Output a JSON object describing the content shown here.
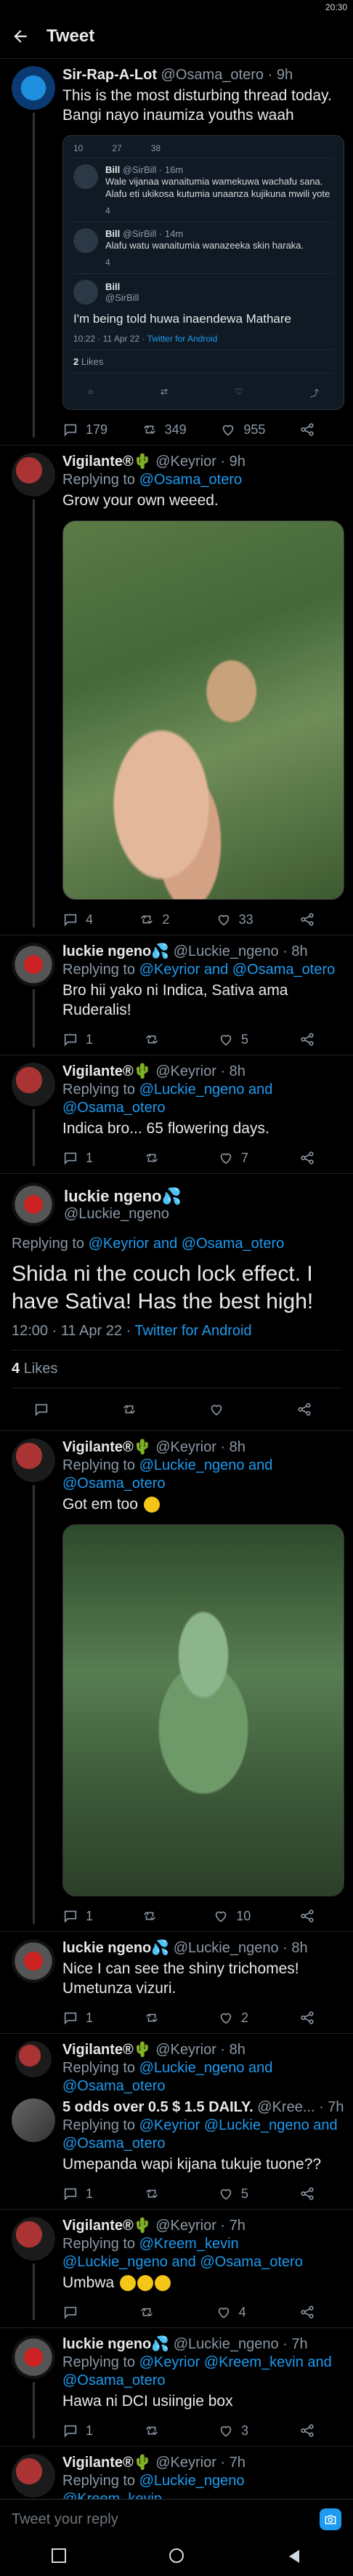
{
  "status": {
    "time": "20:30",
    "network": "4G",
    "battery": ""
  },
  "header": {
    "title": "Tweet"
  },
  "tweets": [
    {
      "name": "Sir-Rap-A-Lot",
      "handle": "@Osama_otero",
      "time": "9h",
      "text": "This is the most disturbing thread today. Bangi nayo inaumiza youths waah",
      "quote": {
        "rows": [
          {
            "name": "Bill",
            "handle": "@SirBill",
            "time": "16m",
            "text": "Wale vijanaa wanaitumia wamekuwa wachafu sana. Alafu eti ukikosa kutumia unaanza kujikuna mwili yote",
            "replies": "",
            "retweets": "",
            "likes": "4"
          },
          {
            "name": "Bill",
            "handle": "@SirBill",
            "time": "14m",
            "text": "Alafu watu wanaitumia wanazeeka skin haraka.",
            "replies": "",
            "retweets": "",
            "likes": "4"
          }
        ],
        "top_counts": {
          "replies": "10",
          "retweets": "27",
          "likes": "38"
        },
        "main_name": "Bill",
        "main_handle": "@SirBill",
        "main_text": "I'm being told huwa inaendewa Mathare",
        "main_meta": "10:22 · 11 Apr 22 · ",
        "main_meta_link": "Twitter for Android",
        "likes_count": "2",
        "likes_label": "Likes"
      },
      "replies": "179",
      "retweets": "349",
      "likes": "955"
    },
    {
      "name": "Vigilante®🌵",
      "handle": "@Keyrior",
      "time": "9h",
      "reply_to_prefix": "Replying to",
      "reply_to": "@Osama_otero",
      "text": "Grow your own weeed.",
      "replies": "4",
      "retweets": "2",
      "likes": "33"
    },
    {
      "name": "luckie ngeno💦",
      "handle": "@Luckie_ngeno",
      "time": "8h",
      "reply_to_prefix": "Replying to",
      "reply_to": "@Keyrior and @Osama_otero",
      "text": "Bro hii yako ni Indica, Sativa ama Ruderalis!",
      "replies": "1",
      "retweets": "",
      "likes": "5"
    },
    {
      "name": "Vigilante®🌵",
      "handle": "@Keyrior",
      "time": "8h",
      "reply_to_prefix": "Replying to",
      "reply_to": "@Luckie_ngeno and @Osama_otero",
      "text": "Indica bro... 65 flowering days.",
      "replies": "1",
      "retweets": "",
      "likes": "7"
    }
  ],
  "main_tweet": {
    "name": "luckie ngeno💦",
    "handle": "@Luckie_ngeno",
    "reply_to_prefix": "Replying to",
    "reply_to": "@Keyrior and @Osama_otero",
    "text": "Shida ni the couch lock effect. I have Sativa! Has the best high!",
    "meta": "12:00 · 11 Apr 22 · ",
    "meta_link": "Twitter for Android",
    "likes_count": "4",
    "likes_label": "Likes"
  },
  "replies_after": [
    {
      "name": "Vigilante®🌵",
      "handle": "@Keyrior",
      "time": "8h",
      "reply_to_prefix": "Replying to",
      "reply_to": "@Luckie_ngeno and @Osama_otero",
      "text": "Got em too",
      "replies": "1",
      "retweets": "",
      "likes": "10"
    },
    {
      "name": "luckie ngeno💦",
      "handle": "@Luckie_ngeno",
      "time": "8h",
      "text": "Nice I can see the shiny trichomes! Umetunza vizuri.",
      "replies": "1",
      "retweets": "",
      "likes": "2"
    },
    {
      "name": "Vigilante®🌵",
      "handle": "@Keyrior",
      "time": "8h",
      "reply_to_prefix": "Replying to",
      "reply_to": "@Luckie_ngeno and @Osama_otero",
      "text": "",
      "replies": "",
      "retweets": "",
      "likes": ""
    },
    {
      "name": "5 odds over 0.5 $ 1.5 DAILY.",
      "handle": "@Kree...",
      "time": "7h",
      "reply_to_prefix": "Replying to",
      "reply_to": "@Keyrior @Luckie_ngeno and @Osama_otero",
      "text": "Umepanda wapi kijana tukuje tuone??",
      "replies": "1",
      "retweets": "",
      "likes": "5"
    },
    {
      "name": "Vigilante®🌵",
      "handle": "@Keyrior",
      "time": "7h",
      "reply_to_prefix": "Replying to",
      "reply_to": "@Kreem_kevin @Luckie_ngeno and @Osama_otero",
      "text": "Umbwa",
      "replies": "",
      "retweets": "",
      "likes": "4"
    },
    {
      "name": "luckie ngeno💦",
      "handle": "@Luckie_ngeno",
      "time": "7h",
      "reply_to_prefix": "Replying to",
      "reply_to": "@Keyrior @Kreem_kevin and @Osama_otero",
      "text": "Hawa ni DCI usiingie box",
      "replies": "1",
      "retweets": "",
      "likes": "3"
    },
    {
      "name": "Vigilante®🌵",
      "handle": "@Keyrior",
      "time": "7h",
      "reply_to_prefix": "Replying to",
      "reply_to": "@Luckie_ngeno @Kreem_kevin",
      "text": "",
      "replies": "",
      "retweets": "",
      "likes": ""
    }
  ],
  "composer": {
    "placeholder": "Tweet your reply"
  }
}
